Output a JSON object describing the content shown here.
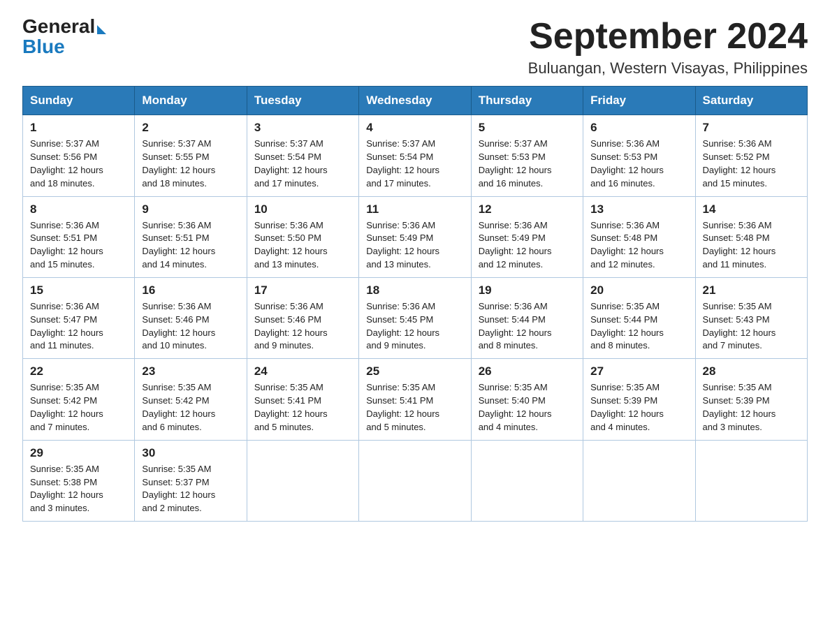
{
  "header": {
    "logo_general": "General",
    "logo_blue": "Blue",
    "title": "September 2024",
    "subtitle": "Buluangan, Western Visayas, Philippines"
  },
  "weekdays": [
    "Sunday",
    "Monday",
    "Tuesday",
    "Wednesday",
    "Thursday",
    "Friday",
    "Saturday"
  ],
  "weeks": [
    [
      {
        "day": "1",
        "sunrise": "5:37 AM",
        "sunset": "5:56 PM",
        "daylight": "12 hours and 18 minutes."
      },
      {
        "day": "2",
        "sunrise": "5:37 AM",
        "sunset": "5:55 PM",
        "daylight": "12 hours and 18 minutes."
      },
      {
        "day": "3",
        "sunrise": "5:37 AM",
        "sunset": "5:54 PM",
        "daylight": "12 hours and 17 minutes."
      },
      {
        "day": "4",
        "sunrise": "5:37 AM",
        "sunset": "5:54 PM",
        "daylight": "12 hours and 17 minutes."
      },
      {
        "day": "5",
        "sunrise": "5:37 AM",
        "sunset": "5:53 PM",
        "daylight": "12 hours and 16 minutes."
      },
      {
        "day": "6",
        "sunrise": "5:36 AM",
        "sunset": "5:53 PM",
        "daylight": "12 hours and 16 minutes."
      },
      {
        "day": "7",
        "sunrise": "5:36 AM",
        "sunset": "5:52 PM",
        "daylight": "12 hours and 15 minutes."
      }
    ],
    [
      {
        "day": "8",
        "sunrise": "5:36 AM",
        "sunset": "5:51 PM",
        "daylight": "12 hours and 15 minutes."
      },
      {
        "day": "9",
        "sunrise": "5:36 AM",
        "sunset": "5:51 PM",
        "daylight": "12 hours and 14 minutes."
      },
      {
        "day": "10",
        "sunrise": "5:36 AM",
        "sunset": "5:50 PM",
        "daylight": "12 hours and 13 minutes."
      },
      {
        "day": "11",
        "sunrise": "5:36 AM",
        "sunset": "5:49 PM",
        "daylight": "12 hours and 13 minutes."
      },
      {
        "day": "12",
        "sunrise": "5:36 AM",
        "sunset": "5:49 PM",
        "daylight": "12 hours and 12 minutes."
      },
      {
        "day": "13",
        "sunrise": "5:36 AM",
        "sunset": "5:48 PM",
        "daylight": "12 hours and 12 minutes."
      },
      {
        "day": "14",
        "sunrise": "5:36 AM",
        "sunset": "5:48 PM",
        "daylight": "12 hours and 11 minutes."
      }
    ],
    [
      {
        "day": "15",
        "sunrise": "5:36 AM",
        "sunset": "5:47 PM",
        "daylight": "12 hours and 11 minutes."
      },
      {
        "day": "16",
        "sunrise": "5:36 AM",
        "sunset": "5:46 PM",
        "daylight": "12 hours and 10 minutes."
      },
      {
        "day": "17",
        "sunrise": "5:36 AM",
        "sunset": "5:46 PM",
        "daylight": "12 hours and 9 minutes."
      },
      {
        "day": "18",
        "sunrise": "5:36 AM",
        "sunset": "5:45 PM",
        "daylight": "12 hours and 9 minutes."
      },
      {
        "day": "19",
        "sunrise": "5:36 AM",
        "sunset": "5:44 PM",
        "daylight": "12 hours and 8 minutes."
      },
      {
        "day": "20",
        "sunrise": "5:35 AM",
        "sunset": "5:44 PM",
        "daylight": "12 hours and 8 minutes."
      },
      {
        "day": "21",
        "sunrise": "5:35 AM",
        "sunset": "5:43 PM",
        "daylight": "12 hours and 7 minutes."
      }
    ],
    [
      {
        "day": "22",
        "sunrise": "5:35 AM",
        "sunset": "5:42 PM",
        "daylight": "12 hours and 7 minutes."
      },
      {
        "day": "23",
        "sunrise": "5:35 AM",
        "sunset": "5:42 PM",
        "daylight": "12 hours and 6 minutes."
      },
      {
        "day": "24",
        "sunrise": "5:35 AM",
        "sunset": "5:41 PM",
        "daylight": "12 hours and 5 minutes."
      },
      {
        "day": "25",
        "sunrise": "5:35 AM",
        "sunset": "5:41 PM",
        "daylight": "12 hours and 5 minutes."
      },
      {
        "day": "26",
        "sunrise": "5:35 AM",
        "sunset": "5:40 PM",
        "daylight": "12 hours and 4 minutes."
      },
      {
        "day": "27",
        "sunrise": "5:35 AM",
        "sunset": "5:39 PM",
        "daylight": "12 hours and 4 minutes."
      },
      {
        "day": "28",
        "sunrise": "5:35 AM",
        "sunset": "5:39 PM",
        "daylight": "12 hours and 3 minutes."
      }
    ],
    [
      {
        "day": "29",
        "sunrise": "5:35 AM",
        "sunset": "5:38 PM",
        "daylight": "12 hours and 3 minutes."
      },
      {
        "day": "30",
        "sunrise": "5:35 AM",
        "sunset": "5:37 PM",
        "daylight": "12 hours and 2 minutes."
      },
      null,
      null,
      null,
      null,
      null
    ]
  ]
}
